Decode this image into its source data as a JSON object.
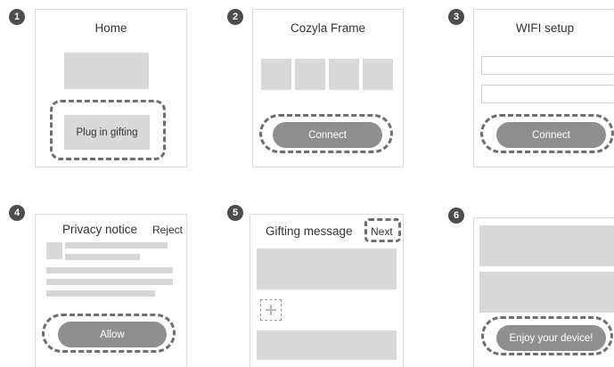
{
  "steps": [
    {
      "number": "1",
      "title": "Home",
      "button": "Plug in gifting"
    },
    {
      "number": "2",
      "title": "Cozyla Frame",
      "button": "Connect"
    },
    {
      "number": "3",
      "title": "WIFI setup",
      "button": "Connect"
    },
    {
      "number": "4",
      "title": "Privacy notice",
      "secondary_action": "Reject",
      "button": "Allow"
    },
    {
      "number": "5",
      "title": "Gifting message",
      "secondary_action": "Next",
      "add_icon": "plus-icon"
    },
    {
      "number": "6",
      "button": "Enjoy your device!"
    }
  ],
  "colors": {
    "badge": "#4d4d4d",
    "button_fill": "#8f8f8f",
    "placeholder_fill": "#d9d9d9",
    "dashed_outline": "#6f6f6f",
    "panel_border": "#dcdcdc"
  }
}
